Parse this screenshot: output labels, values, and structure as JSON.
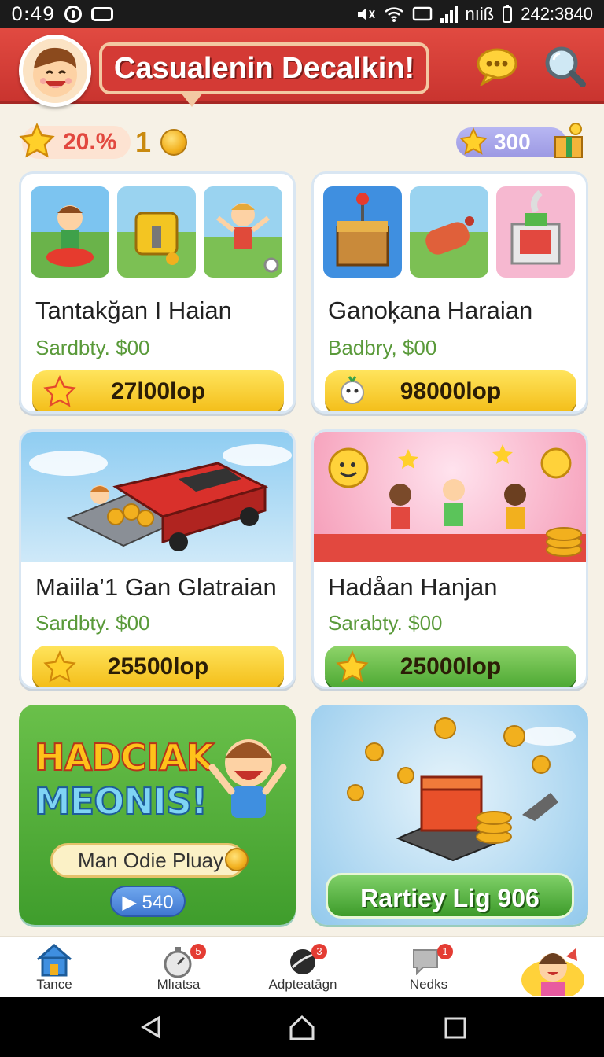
{
  "status_bar": {
    "time": "0:49",
    "right_text": "nıiß",
    "clock": "242:3840"
  },
  "header": {
    "title": "Casualenin Decalkin!"
  },
  "currency": {
    "percent": "20.%",
    "count": "1",
    "stars": "300"
  },
  "cards": [
    {
      "title": "Tantakğan I Haian",
      "subtitle": "Sardbty. $00",
      "button": "27l00lop",
      "button_style": "yellow"
    },
    {
      "title": "Ganoķana Haraian",
      "subtitle": "Badbry, $00",
      "button": "98000lop",
      "button_style": "yellow"
    },
    {
      "title": "Maiila’1 Gan Glatraian",
      "subtitle": "Sardbty. $00",
      "button": "25500lop",
      "button_style": "yellow"
    },
    {
      "title": "Hadåan Hanjan",
      "subtitle": "Sarabty. $00",
      "button": "25000lop",
      "button_style": "green"
    }
  ],
  "promo": {
    "line1": "HADCIAK",
    "line2": "MEONIS!",
    "pill": "Man Odie Pluay",
    "play": "▶ 540"
  },
  "reward": {
    "button": "Rartiey Lig 906"
  },
  "nav": [
    {
      "label": "Tance",
      "badge": ""
    },
    {
      "label": "Mlıatsa",
      "badge": "5"
    },
    {
      "label": "Adpteatāgn",
      "badge": "3"
    },
    {
      "label": "Nedks",
      "badge": "1"
    }
  ],
  "colors": {
    "header_red": "#d43a35",
    "button_yellow": "#f3bd18",
    "button_green": "#4ca832",
    "subtitle_green": "#5a9a3a"
  }
}
